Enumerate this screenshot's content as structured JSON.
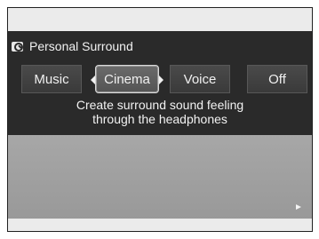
{
  "header": {
    "title": "Personal Surround"
  },
  "options": [
    {
      "label": "Music",
      "selected": false
    },
    {
      "label": "Cinema",
      "selected": true
    },
    {
      "label": "Voice",
      "selected": false
    },
    {
      "label": "Off",
      "selected": false
    }
  ],
  "description": {
    "line1": "Create surround sound feeling",
    "line2": "through the headphones"
  },
  "icons": {
    "title_icon": "surround-sound-icon",
    "next_icon": "play-arrow-icon"
  }
}
